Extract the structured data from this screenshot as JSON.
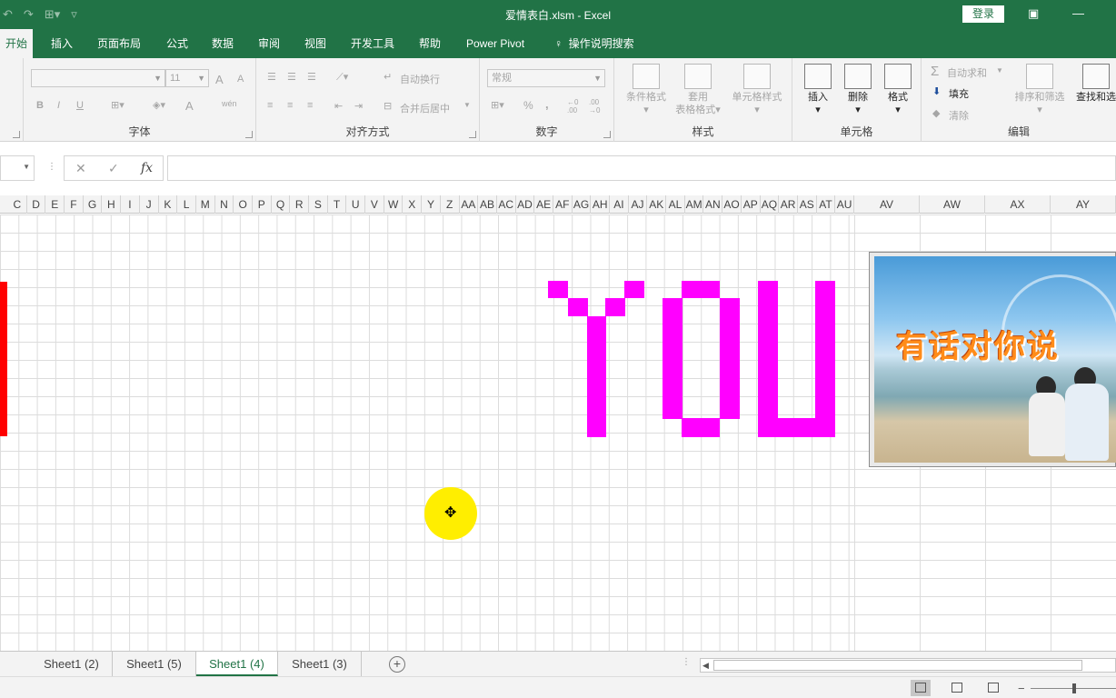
{
  "window": {
    "title": "爱情表白.xlsm  -  Excel",
    "login_label": "登录",
    "restore_icon": "ribbon-display-icon",
    "minimize_label": "—"
  },
  "ribbon_tabs": [
    "开始",
    "插入",
    "页面布局",
    "公式",
    "数据",
    "审阅",
    "视图",
    "开发工具",
    "帮助",
    "Power Pivot"
  ],
  "tell_me": "操作说明搜索",
  "ribbon": {
    "font": {
      "name_value": "",
      "size_value": "11",
      "grow": "A",
      "shrink": "A",
      "bold": "B",
      "italic": "I",
      "underline": "U",
      "color": "A",
      "phonetic": "wén",
      "label": "字体"
    },
    "alignment": {
      "wrap_label": "自动换行",
      "merge_label": "合并后居中",
      "label": "对齐方式"
    },
    "number": {
      "format_value": "常规",
      "percent": "%",
      "comma": ",",
      "inc_dec": "←0 .00",
      "dec_dec": ".00 →0",
      "label": "数字"
    },
    "styles": {
      "cond_format": "条件格式",
      "table_format_1": "套用",
      "table_format_2": "表格格式",
      "cell_styles": "单元格样式",
      "label": "样式"
    },
    "cells": {
      "insert": "插入",
      "delete": "删除",
      "format": "格式",
      "label": "单元格"
    },
    "editing": {
      "autosum": "自动求和",
      "fill": "填充",
      "clear": "清除",
      "sort_filter": "排序和筛选",
      "find_select": "查找和选",
      "label": "编辑"
    }
  },
  "formula_bar": {
    "cancel": "✕",
    "enter": "✓",
    "fx": "fx",
    "value": ""
  },
  "columns_narrow": [
    "C",
    "D",
    "E",
    "F",
    "G",
    "H",
    "I",
    "J",
    "K",
    "L",
    "M",
    "N",
    "O",
    "P",
    "Q",
    "R",
    "S",
    "T",
    "U",
    "V",
    "W",
    "X",
    "Y",
    "Z",
    "AA",
    "AB",
    "AC",
    "AD",
    "AE",
    "AF",
    "AG",
    "AH",
    "AI",
    "AJ",
    "AK",
    "AL",
    "AM",
    "AN",
    "AO",
    "AP",
    "AQ",
    "AR",
    "AS",
    "AT",
    "AU"
  ],
  "columns_wide": [
    "AV",
    "AW",
    "AX",
    "AY"
  ],
  "picture": {
    "caption": "有话对你说"
  },
  "sheet_tabs": [
    "Sheet1 (2)",
    "Sheet1 (5)",
    "Sheet1 (4)",
    "Sheet1 (3)"
  ],
  "active_sheet": "Sheet1 (4)",
  "status": {
    "zoom_minus": "−"
  },
  "colors": {
    "excel_green": "#217346",
    "pixel_magenta": "#ff00ff",
    "pixel_red": "#ff0000",
    "cursor_highlight": "#ffee00"
  }
}
